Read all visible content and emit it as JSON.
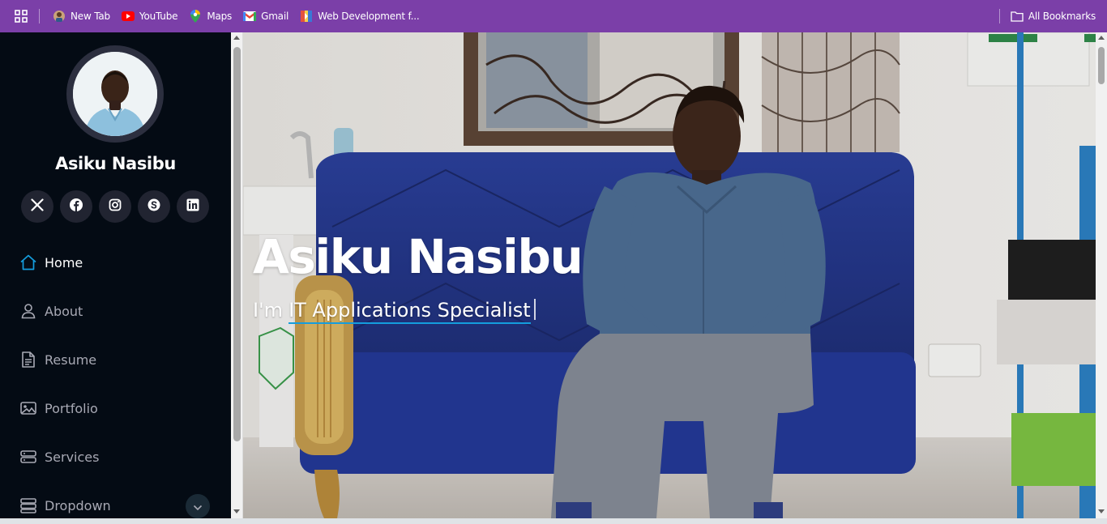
{
  "bookmarks_bar": {
    "items": [
      {
        "label": "New Tab",
        "icon": "new-tab-icon"
      },
      {
        "label": "YouTube",
        "icon": "youtube-icon"
      },
      {
        "label": "Maps",
        "icon": "maps-icon"
      },
      {
        "label": "Gmail",
        "icon": "gmail-icon"
      },
      {
        "label": "Web Development f...",
        "icon": "web-development-icon"
      }
    ],
    "all_bookmarks_label": "All Bookmarks"
  },
  "sidebar": {
    "profile_name": "Asiku Nasibu",
    "socials": [
      "x-twitter-icon",
      "facebook-icon",
      "instagram-icon",
      "skype-icon",
      "linkedin-icon"
    ],
    "nav": [
      {
        "label": "Home",
        "icon": "house-icon",
        "active": true
      },
      {
        "label": "About",
        "icon": "person-icon",
        "active": false
      },
      {
        "label": "Resume",
        "icon": "document-icon",
        "active": false
      },
      {
        "label": "Portfolio",
        "icon": "images-icon",
        "active": false
      },
      {
        "label": "Services",
        "icon": "server-icon",
        "active": false
      },
      {
        "label": "Dropdown",
        "icon": "menu-icon",
        "active": false
      }
    ]
  },
  "hero": {
    "title": "Asiku Nasibu",
    "subtitle_prefix": "I'm",
    "typed_role": "IT Applications Specialist"
  },
  "colors": {
    "bookmarks_bar": "#7b3fa8",
    "sidebar_bg": "#040b14",
    "accent": "#149ddd",
    "social_bg": "#212431"
  }
}
